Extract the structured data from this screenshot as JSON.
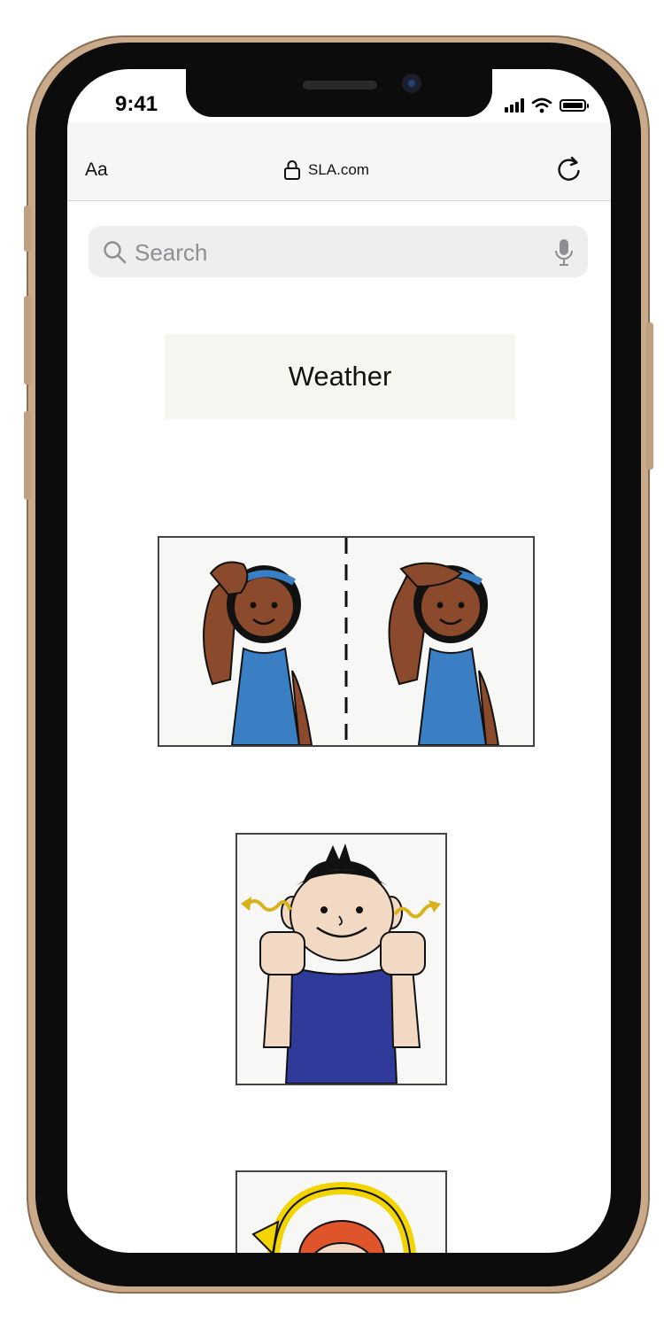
{
  "status_bar": {
    "time": "9:41"
  },
  "browser": {
    "text_size_label": "Aa",
    "url": "SLA.com",
    "icons": {
      "lock": "lock-icon",
      "reload": "reload-icon"
    }
  },
  "search": {
    "placeholder": "Search",
    "icons": {
      "search": "search-icon",
      "mic": "microphone-icon"
    }
  },
  "page": {
    "title": "Weather",
    "images": [
      {
        "name": "sign-sun-illustration",
        "kind": "two-panel sign illustration"
      },
      {
        "name": "sign-windy-illustration",
        "kind": "sign illustration"
      },
      {
        "name": "sign-rain-illustration",
        "kind": "sign illustration (partially visible)"
      }
    ]
  },
  "colors": {
    "accent_frame": "#c9ab8c",
    "skin_dark": "#8a4a2b",
    "shirt_blue": "#3a7fc4",
    "navy": "#2f3a9a"
  }
}
